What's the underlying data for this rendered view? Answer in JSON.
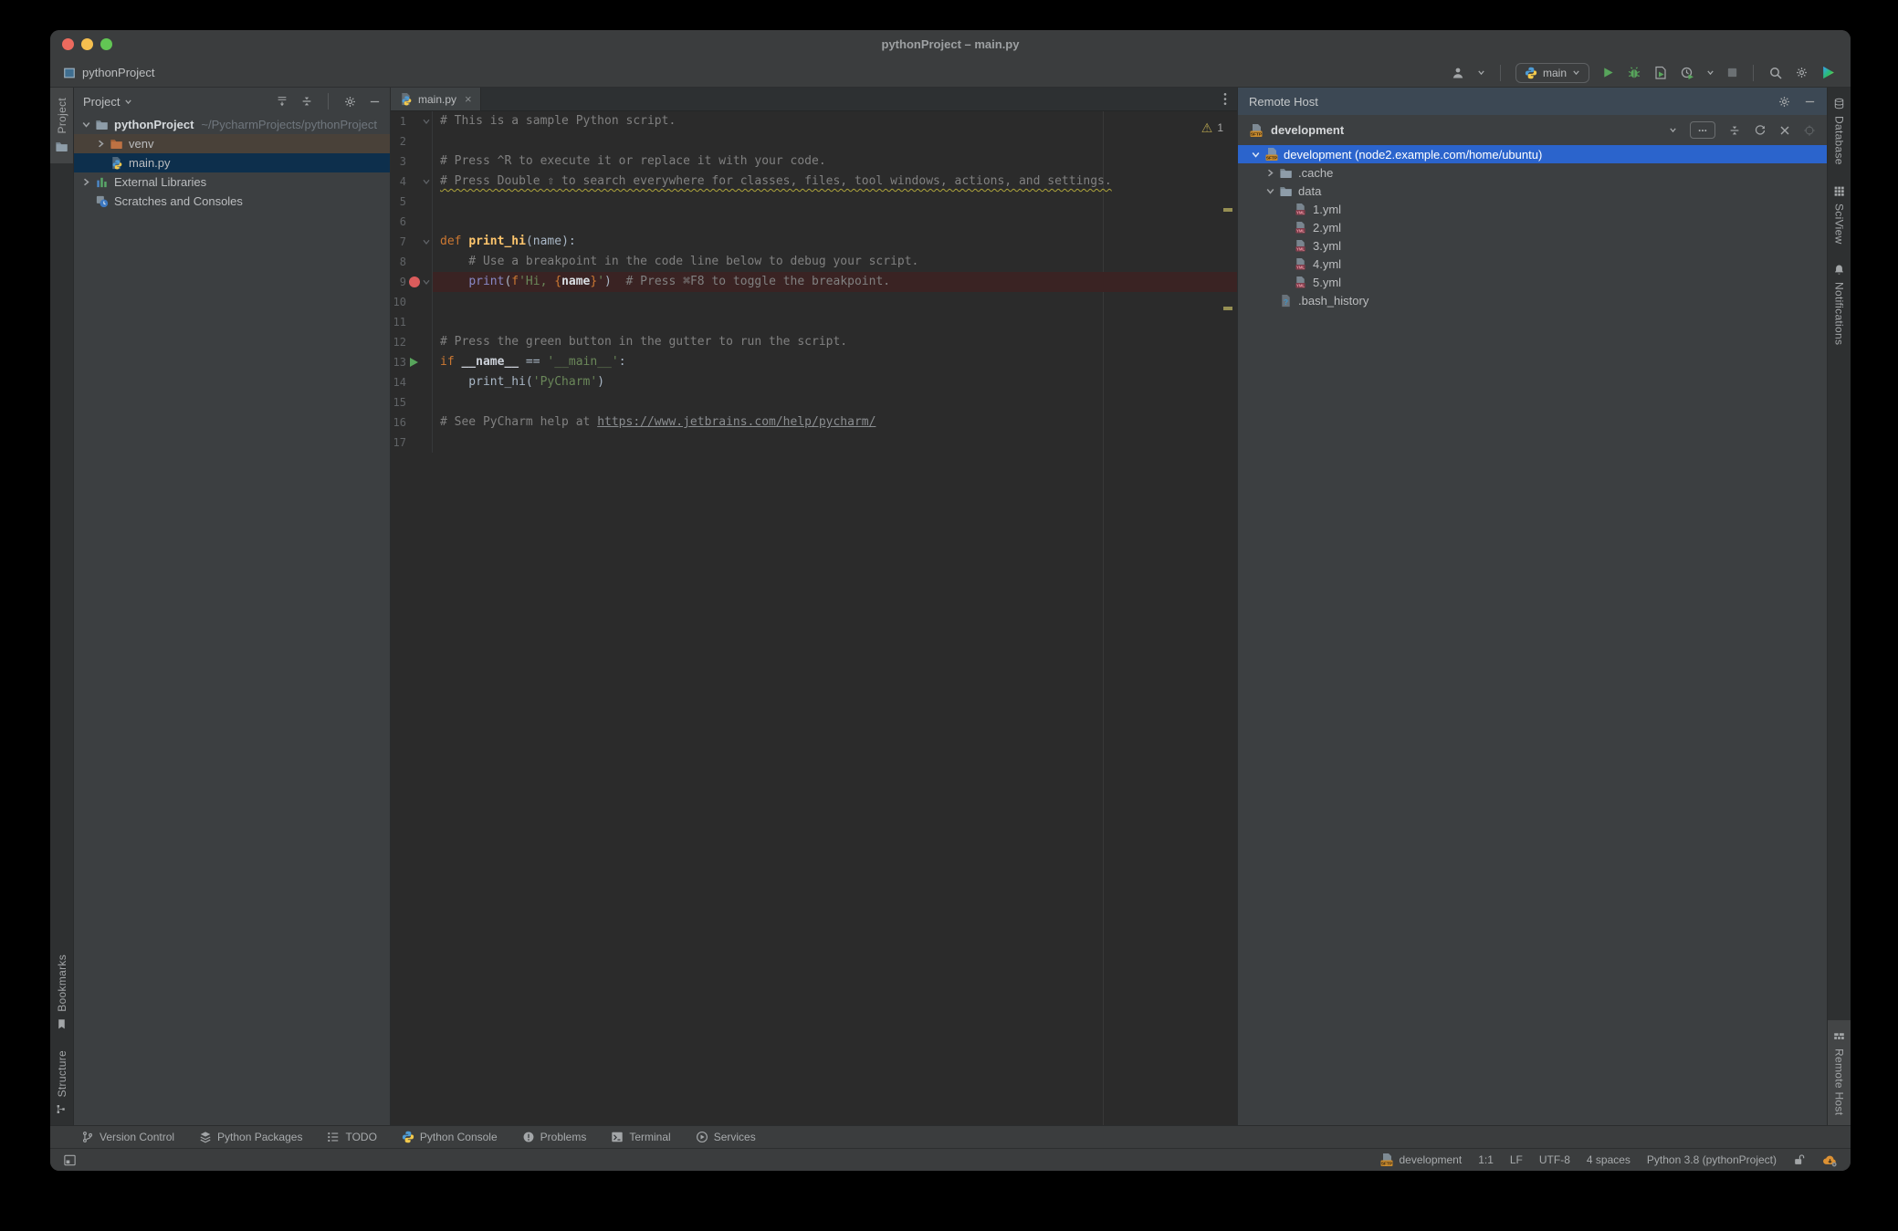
{
  "colors": {
    "selection_blue": "#2B64CC",
    "breakpoint_line": "#3A2323",
    "breakpoint_dot": "#DB5C5C",
    "run_green": "#58A55C",
    "warning_squiggle": "#AEA43B",
    "venv_row": "#494139",
    "selected_file_row": "#0D2F4C",
    "sftp_badge_orange": "#C98A2C",
    "remote_header_bg": "#3C4854",
    "editor_bg": "#2B2B2B",
    "panel_bg": "#3C3F41"
  },
  "window": {
    "title": "pythonProject – main.py",
    "project_breadcrumb": "pythonProject"
  },
  "toolbar": {
    "run_config": "main"
  },
  "left_stripe": {
    "top": [
      {
        "label": "Project",
        "icon": "folder",
        "active": true
      }
    ],
    "bottom": [
      {
        "label": "Bookmarks",
        "icon": "bookmark",
        "active": false
      },
      {
        "label": "Structure",
        "icon": "structure",
        "active": false
      }
    ]
  },
  "right_stripe": {
    "top": [
      {
        "label": "Database",
        "icon": "database",
        "active": false
      },
      {
        "label": "SciView",
        "icon": "sciview",
        "active": false
      },
      {
        "label": "Notifications",
        "icon": "bell",
        "active": false
      }
    ],
    "bottom": [
      {
        "label": "Remote Host",
        "icon": "remote",
        "active": true
      }
    ]
  },
  "project_panel": {
    "title": "Project",
    "tree": [
      {
        "indent": 0,
        "chevron": "down",
        "icon": "folder",
        "label": "pythonProject",
        "bold": true,
        "suffix": "~/PycharmProjects/pythonProject"
      },
      {
        "indent": 1,
        "chevron": "right",
        "icon": "folder-orange",
        "label": "venv",
        "bg": "venv_row"
      },
      {
        "indent": 1,
        "chevron": "",
        "icon": "pyfile",
        "label": "main.py",
        "bg": "selected_file_row"
      },
      {
        "indent": 0,
        "chevron": "right",
        "icon": "libs",
        "label": "External Libraries"
      },
      {
        "indent": 0,
        "chevron": "",
        "icon": "scratch",
        "label": "Scratches and Consoles"
      }
    ]
  },
  "editor": {
    "tab": "main.py",
    "warning_count": "1",
    "lines": [
      {
        "n": 1,
        "fold": true,
        "g": "",
        "bp": false,
        "wavy": false,
        "seg": [
          {
            "c": "com",
            "t": "# This is a sample Python script."
          }
        ]
      },
      {
        "n": 2,
        "fold": false,
        "g": "",
        "bp": false,
        "wavy": false,
        "seg": []
      },
      {
        "n": 3,
        "fold": false,
        "g": "",
        "bp": false,
        "wavy": false,
        "seg": [
          {
            "c": "com",
            "t": "# Press ^R to execute it or replace it with your code."
          }
        ]
      },
      {
        "n": 4,
        "fold": true,
        "g": "",
        "bp": false,
        "wavy": true,
        "seg": [
          {
            "c": "com",
            "t": "# Press Double ⇧ to search everywhere for classes, files, tool windows, actions, and settings."
          }
        ]
      },
      {
        "n": 5,
        "fold": false,
        "g": "",
        "bp": false,
        "wavy": false,
        "seg": []
      },
      {
        "n": 6,
        "fold": false,
        "g": "",
        "bp": false,
        "wavy": false,
        "seg": []
      },
      {
        "n": 7,
        "fold": true,
        "g": "",
        "bp": false,
        "wavy": false,
        "seg": [
          {
            "c": "kw",
            "t": "def "
          },
          {
            "c": "fn",
            "t": "print_hi"
          },
          {
            "c": "txt",
            "t": "(name):"
          }
        ]
      },
      {
        "n": 8,
        "fold": false,
        "g": "",
        "bp": false,
        "wavy": false,
        "seg": [
          {
            "c": "com",
            "t": "    # Use a breakpoint in the code line below to debug your script."
          }
        ]
      },
      {
        "n": 9,
        "fold": true,
        "g": "bp",
        "bp": true,
        "wavy": false,
        "seg": [
          {
            "c": "txt",
            "t": "    "
          },
          {
            "c": "bi",
            "t": "print"
          },
          {
            "c": "txt",
            "t": "("
          },
          {
            "c": "kw",
            "t": "f"
          },
          {
            "c": "str",
            "t": "'Hi, "
          },
          {
            "c": "kw",
            "t": "{"
          },
          {
            "c": "bold",
            "t": "name"
          },
          {
            "c": "kw",
            "t": "}"
          },
          {
            "c": "str",
            "t": "'"
          },
          {
            "c": "txt",
            "t": ")  "
          },
          {
            "c": "com",
            "t": "# Press ⌘F8 to toggle the breakpoint."
          }
        ]
      },
      {
        "n": 10,
        "fold": false,
        "g": "",
        "bp": false,
        "wavy": false,
        "seg": []
      },
      {
        "n": 11,
        "fold": false,
        "g": "",
        "bp": false,
        "wavy": false,
        "seg": []
      },
      {
        "n": 12,
        "fold": false,
        "g": "",
        "bp": false,
        "wavy": false,
        "seg": [
          {
            "c": "com",
            "t": "# Press the green button in the gutter to run the script."
          }
        ]
      },
      {
        "n": 13,
        "fold": false,
        "g": "run",
        "bp": false,
        "wavy": false,
        "seg": [
          {
            "c": "kw",
            "t": "if "
          },
          {
            "c": "dun",
            "t": "__name__"
          },
          {
            "c": "txt",
            "t": " == "
          },
          {
            "c": "str",
            "t": "'__main__'"
          },
          {
            "c": "txt",
            "t": ":"
          }
        ]
      },
      {
        "n": 14,
        "fold": false,
        "g": "",
        "bp": false,
        "wavy": false,
        "seg": [
          {
            "c": "txt",
            "t": "    print_hi("
          },
          {
            "c": "str",
            "t": "'PyCharm'"
          },
          {
            "c": "txt",
            "t": ")"
          }
        ]
      },
      {
        "n": 15,
        "fold": false,
        "g": "",
        "bp": false,
        "wavy": false,
        "seg": []
      },
      {
        "n": 16,
        "fold": false,
        "g": "",
        "bp": false,
        "wavy": false,
        "seg": [
          {
            "c": "com",
            "t": "# See PyCharm help at "
          },
          {
            "c": "link",
            "t": "https://www.jetbrains.com/help/pycharm/"
          }
        ]
      },
      {
        "n": 17,
        "fold": false,
        "g": "",
        "bp": false,
        "wavy": false,
        "seg": []
      }
    ]
  },
  "remote_panel": {
    "title": "Remote Host",
    "server": "development",
    "more_button": "...",
    "tree": [
      {
        "indent": 0,
        "chevron": "down",
        "icon": "sftp",
        "label": "development (node2.example.com/home/ubuntu)",
        "selected": true
      },
      {
        "indent": 1,
        "chevron": "right",
        "icon": "folder",
        "label": ".cache"
      },
      {
        "indent": 1,
        "chevron": "down",
        "icon": "folder",
        "label": "data"
      },
      {
        "indent": 2,
        "chevron": "",
        "icon": "yml",
        "label": "1.yml"
      },
      {
        "indent": 2,
        "chevron": "",
        "icon": "yml",
        "label": "2.yml"
      },
      {
        "indent": 2,
        "chevron": "",
        "icon": "yml",
        "label": "3.yml"
      },
      {
        "indent": 2,
        "chevron": "",
        "icon": "yml",
        "label": "4.yml"
      },
      {
        "indent": 2,
        "chevron": "",
        "icon": "yml",
        "label": "5.yml"
      },
      {
        "indent": 1,
        "chevron": "",
        "icon": "qfile",
        "label": ".bash_history"
      }
    ]
  },
  "bottom_bar": {
    "items": [
      {
        "label": "Version Control",
        "icon": "branch"
      },
      {
        "label": "Python Packages",
        "icon": "packages"
      },
      {
        "label": "TODO",
        "icon": "todo"
      },
      {
        "label": "Python Console",
        "icon": "pylogo"
      },
      {
        "label": "Problems",
        "icon": "problem"
      },
      {
        "label": "Terminal",
        "icon": "terminal"
      },
      {
        "label": "Services",
        "icon": "services"
      }
    ]
  },
  "status_bar": {
    "items": [
      {
        "icon": "sftp",
        "label": "development"
      },
      {
        "icon": "",
        "label": "1:1"
      },
      {
        "icon": "",
        "label": "LF"
      },
      {
        "icon": "",
        "label": "UTF-8"
      },
      {
        "icon": "",
        "label": "4 spaces"
      },
      {
        "icon": "",
        "label": "Python 3.8 (pythonProject)"
      },
      {
        "icon": "lock",
        "label": ""
      },
      {
        "icon": "cloud",
        "label": ""
      }
    ]
  }
}
